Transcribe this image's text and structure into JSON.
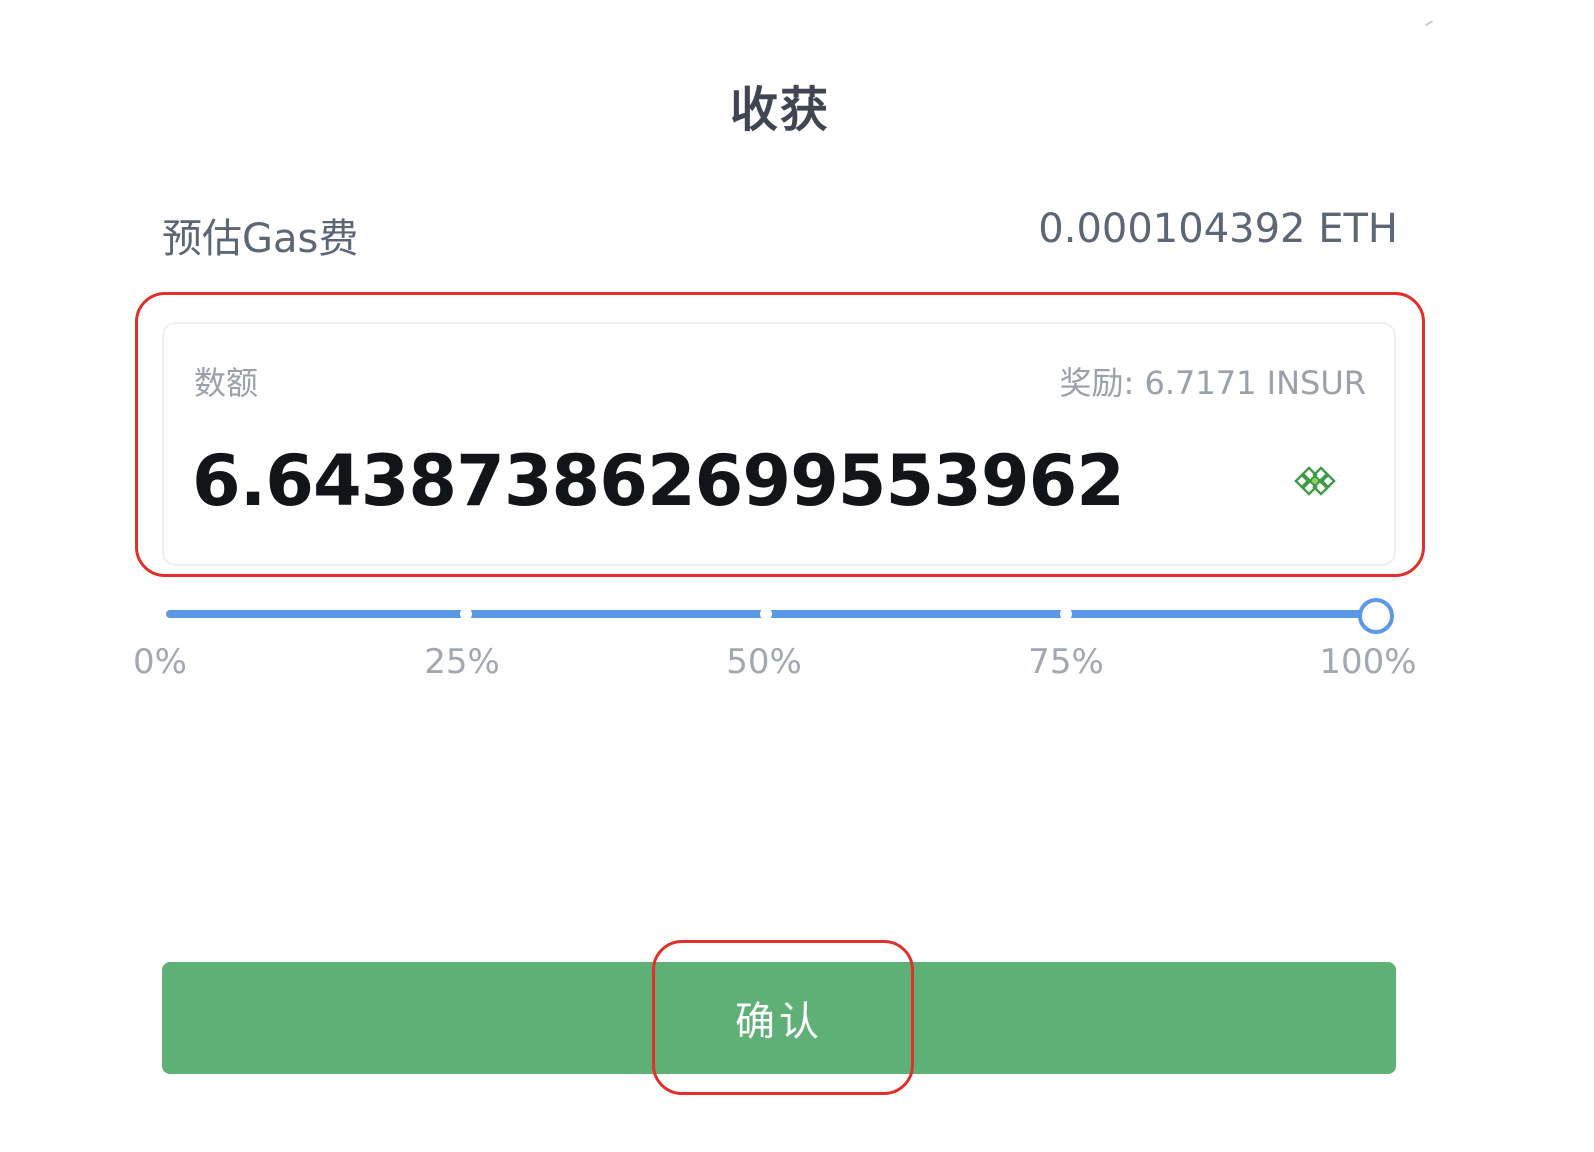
{
  "dialog": {
    "title": "收获"
  },
  "gas": {
    "label": "预估Gas费",
    "value": "0.000104392 ETH"
  },
  "amount": {
    "label": "数额",
    "reward": "奖励: 6.7171 INSUR",
    "value": "6.643873862699553962",
    "max_icon": "diamond-grid-icon"
  },
  "slider": {
    "value_percent": 100,
    "ticks": [
      "0%",
      "25%",
      "50%",
      "75%",
      "100%"
    ],
    "color": "#5b98e6"
  },
  "confirm": {
    "label": "确认",
    "color": "#5fb077"
  },
  "highlight_color": "#e0302a"
}
